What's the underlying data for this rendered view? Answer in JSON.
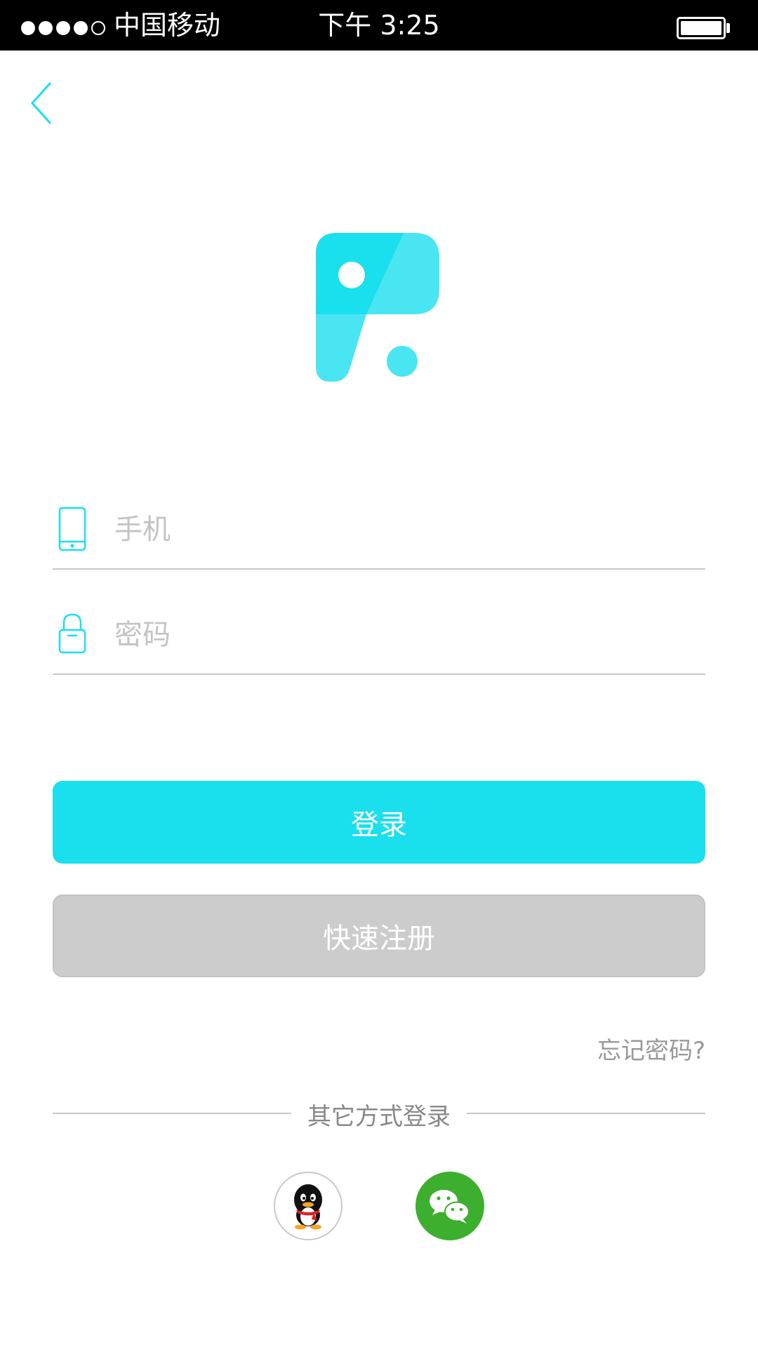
{
  "status_bar": {
    "carrier": "中国移动",
    "time": "下午 3:25",
    "signal_bars": 4,
    "signal_total": 5
  },
  "form": {
    "phone_placeholder": "手机",
    "password_placeholder": "密码"
  },
  "buttons": {
    "login": "登录",
    "register": "快速注册"
  },
  "forgot_password": "忘记密码?",
  "other_login": {
    "label": "其它方式登录",
    "providers": [
      "qq",
      "wechat"
    ]
  },
  "icons": {
    "back": "chevron-left-icon",
    "phone": "phone-icon",
    "lock": "lock-icon"
  },
  "colors": {
    "accent": "#1adfed",
    "logo_light": "#4ae5f2",
    "register_bg": "#cccccc",
    "wechat": "#3daf2f",
    "placeholder": "#c4c4c4"
  }
}
